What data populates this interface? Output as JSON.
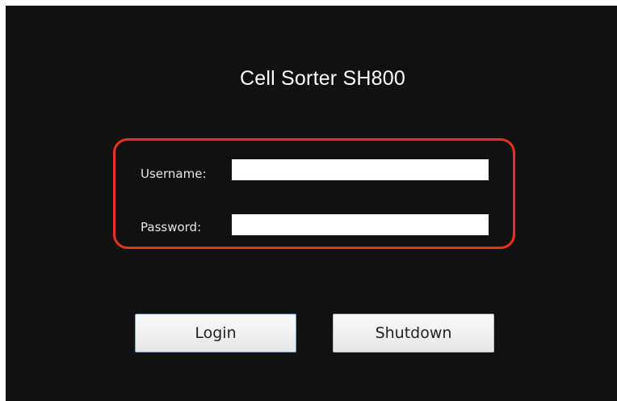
{
  "app": {
    "title": "Cell Sorter SH800"
  },
  "login_form": {
    "username_label": "Username:",
    "username_value": "",
    "password_label": "Password:",
    "password_value": ""
  },
  "buttons": {
    "login_label": "Login",
    "shutdown_label": "Shutdown"
  },
  "colors": {
    "background": "#111111",
    "highlight_border": "#e8321e",
    "title_text": "#ffffff"
  }
}
